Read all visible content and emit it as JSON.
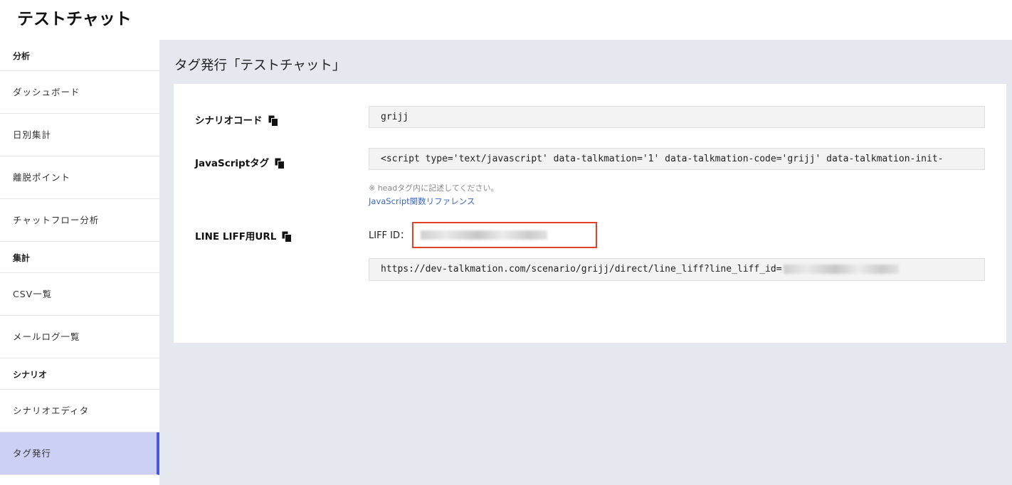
{
  "header": {
    "title": "テストチャット"
  },
  "sidebar": {
    "sections": [
      {
        "label": "分析",
        "items": [
          {
            "label": "ダッシュボード"
          },
          {
            "label": "日別集計"
          },
          {
            "label": "離脱ポイント"
          },
          {
            "label": "チャットフロー分析"
          }
        ]
      },
      {
        "label": "集計",
        "items": [
          {
            "label": "CSV一覧"
          },
          {
            "label": "メールログ一覧"
          }
        ]
      },
      {
        "label": "シナリオ",
        "items": [
          {
            "label": "シナリオエディタ"
          },
          {
            "label": "タグ発行",
            "active": true
          }
        ]
      }
    ]
  },
  "main": {
    "title": "タグ発行「テストチャット」",
    "scenario_code": {
      "label": "シナリオコード",
      "value": "grijj"
    },
    "js_tag": {
      "label": "JavaScriptタグ",
      "value": "<script type='text/javascript' data-talkmation='1' data-talkmation-code='grijj' data-talkmation-init-",
      "note": "※ headタグ内に記述してください。",
      "link": "JavaScript関数リファレンス"
    },
    "liff": {
      "label": "LINE LIFF用URL",
      "id_label": "LIFF ID：",
      "url_prefix": "https://dev-talkmation.com/scenario/grijj/direct/line_liff?line_liff_id="
    }
  },
  "colors": {
    "accent": "#4b57d4",
    "active_bg": "#cdd0f5",
    "highlight": "#e0432a",
    "link": "#3b66c4"
  },
  "icons": {
    "copy": "copy-icon"
  }
}
